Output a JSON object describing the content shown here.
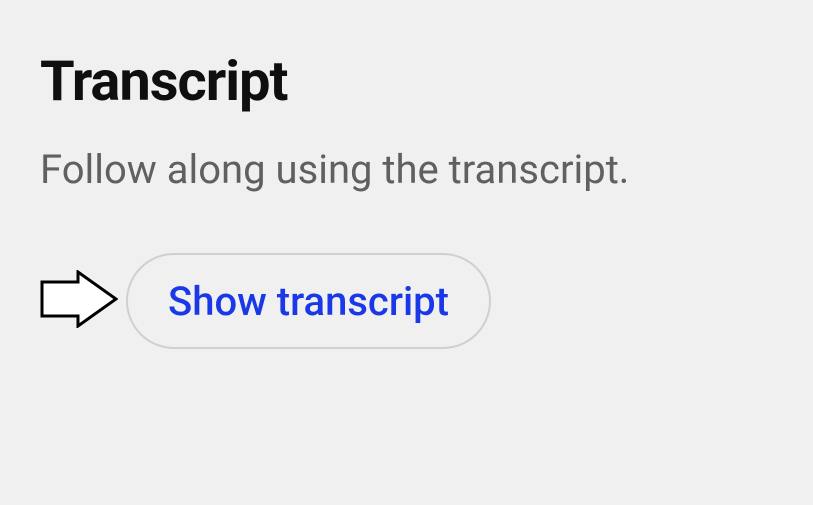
{
  "transcript": {
    "title": "Transcript",
    "description": "Follow along using the transcript.",
    "button_label": "Show transcript"
  }
}
